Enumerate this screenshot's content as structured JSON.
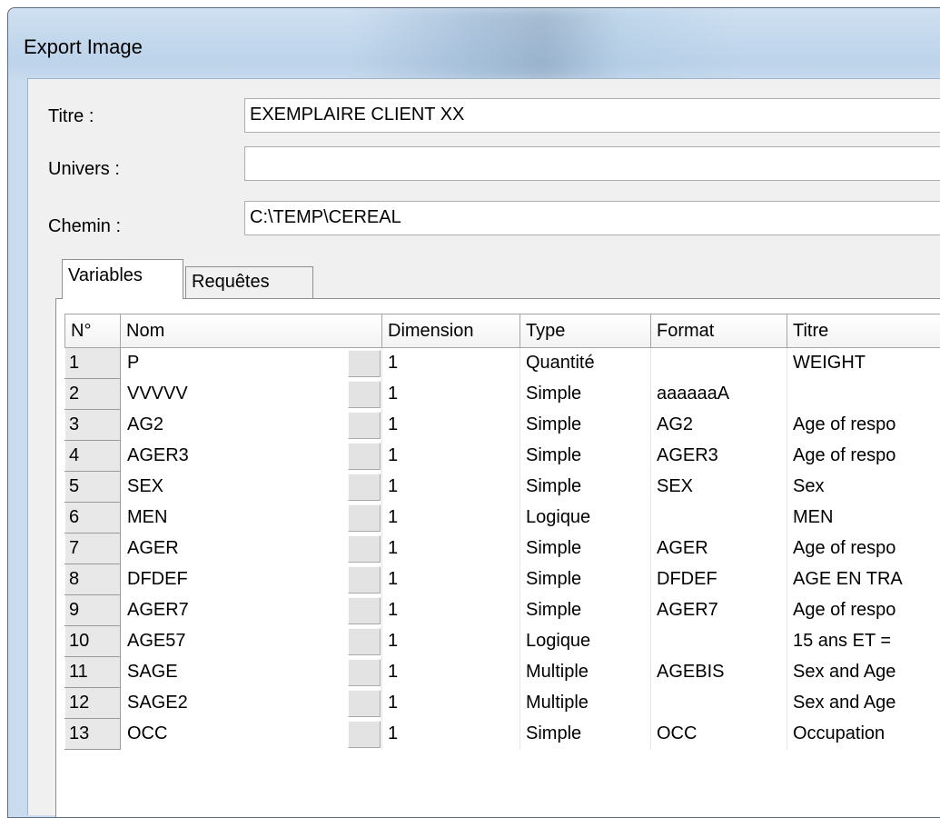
{
  "window": {
    "title": "Export Image"
  },
  "form": {
    "titre_label": "Titre :",
    "titre_value": "EXEMPLAIRE CLIENT XX",
    "univers_label": "Univers :",
    "univers_value": "",
    "chemin_label": "Chemin :",
    "chemin_value": "C:\\TEMP\\CEREAL"
  },
  "tabs": [
    {
      "label": "Variables",
      "active": true
    },
    {
      "label": "Requêtes",
      "active": false
    }
  ],
  "grid": {
    "columns": [
      "N°",
      "Nom",
      "Dimension",
      "Type",
      "Format",
      "Titre"
    ],
    "rows": [
      [
        "1",
        "P",
        "1",
        "Quantité",
        "",
        "WEIGHT"
      ],
      [
        "2",
        "VVVVV",
        "1",
        "Simple",
        "aaaaaaA",
        ""
      ],
      [
        "3",
        "AG2",
        "1",
        "Simple",
        "AG2",
        "Age of respo"
      ],
      [
        "4",
        "AGER3",
        "1",
        "Simple",
        "AGER3",
        "Age of respo"
      ],
      [
        "5",
        "SEX",
        "1",
        "Simple",
        "SEX",
        "Sex"
      ],
      [
        "6",
        "MEN",
        "1",
        "Logique",
        "",
        "MEN"
      ],
      [
        "7",
        "AGER",
        "1",
        "Simple",
        "AGER",
        "Age of respo"
      ],
      [
        "8",
        "DFDEF",
        "1",
        "Simple",
        "DFDEF",
        "AGE EN TRA"
      ],
      [
        "9",
        "AGER7",
        "1",
        "Simple",
        "AGER7",
        "Age of respo"
      ],
      [
        "10",
        "AGE57",
        "1",
        "Logique",
        "",
        "15 ans ET ="
      ],
      [
        "11",
        "SAGE",
        "1",
        "Multiple",
        "AGEBIS",
        "Sex and Age"
      ],
      [
        "12",
        "SAGE2",
        "1",
        "Multiple",
        "",
        "Sex and Age"
      ],
      [
        "13",
        "OCC",
        "1",
        "Simple",
        "OCC",
        "Occupation"
      ]
    ]
  }
}
